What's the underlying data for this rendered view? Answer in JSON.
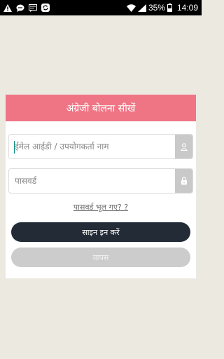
{
  "status_bar": {
    "battery": "35%",
    "time": "14:09"
  },
  "login": {
    "title": "अंग्रेजी बोलना सीखें",
    "email_placeholder": "ईमेल आईडी / उपयोगकर्ता नाम",
    "password_placeholder": "पासवर्ड",
    "forgot_password": "पासवर्ड भूल गए? ?",
    "signin_label": "साइन इन करें",
    "back_label": "वापस"
  },
  "icons": {
    "status_left": [
      "warning-icon",
      "chat-bubble-icon",
      "message-icon",
      "sync-icon"
    ],
    "status_right": [
      "wifi-icon",
      "signal-icon",
      "battery-icon"
    ],
    "email_addon": "user-icon",
    "password_addon": "lock-icon"
  },
  "colors": {
    "header": "#ef7585",
    "signin_button": "#232b36",
    "back_button": "#cccccc",
    "background": "#ece9e1",
    "caret": "#00897b"
  }
}
